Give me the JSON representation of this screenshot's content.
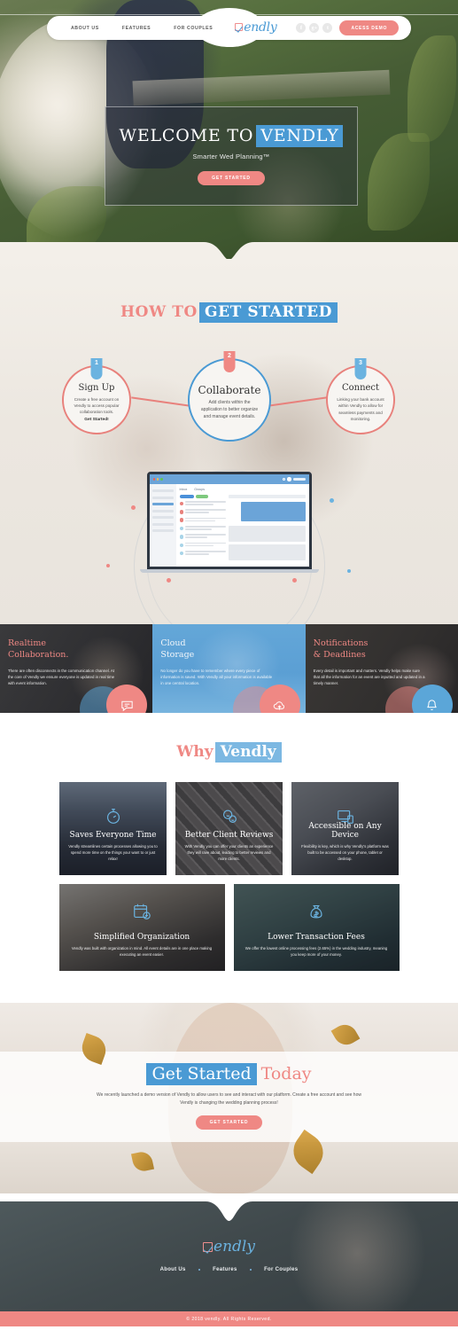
{
  "nav": {
    "links": [
      {
        "label": "ABOUT US",
        "name": "nav-about-us"
      },
      {
        "label": "FEATURES",
        "name": "nav-features"
      },
      {
        "label": "FOR COUPLES",
        "name": "nav-for-couples"
      }
    ],
    "logo": "endly",
    "socials": [
      {
        "name": "facebook-icon",
        "glyph": "f"
      },
      {
        "name": "google-plus-icon",
        "glyph": "g+"
      },
      {
        "name": "twitter-icon",
        "glyph": "t"
      }
    ],
    "demo_button": "ACESS DEMO"
  },
  "hero": {
    "title_prefix": "WELCOME TO",
    "title_highlight": "VENDLY",
    "subtitle": "Smarter Wed Planning™",
    "cta": "GET STARTED"
  },
  "howto": {
    "head_prefix": "HOW TO",
    "head_highlight": "GET STARTED",
    "steps": [
      {
        "number": "1",
        "title": "Sign Up",
        "body": "Create a free account on Vendly to access popular collaboration tools.",
        "cta": "Get Started!"
      },
      {
        "number": "2",
        "title": "Collaborate",
        "body": "Add clients within the application to better organize and manage event details.",
        "cta": ""
      },
      {
        "number": "3",
        "title": "Connect",
        "body": "Linking your bank account within Vendly to allow for seamless payments and monitoring.",
        "cta": ""
      }
    ],
    "app_tabs": [
      "Inbox",
      "Groups"
    ]
  },
  "panels": [
    {
      "title_line1": "Realtime",
      "title_line2": "Collaboration.",
      "body": "There are often disconnects in the communication channel. At the core of Vendly we ensure everyone is updated in real time with event information.",
      "icon": "chat-bubble-icon"
    },
    {
      "title_line1": "Cloud",
      "title_line2": "Storage",
      "body": "No longer do you have to remember where every piece of information is saved. With Vendly all your information is available in one central location.",
      "icon": "cloud-upload-icon"
    },
    {
      "title_line1": "Notifications",
      "title_line2": "& Deadlines",
      "body": "Every detail is important and matters. Vendly helps make sure that all the information for an event are inputted and updated in a timely manner.",
      "icon": "bell-icon"
    }
  ],
  "why": {
    "head_prefix": "Why",
    "head_highlight": "Vendly",
    "cards_row1": [
      {
        "title": "Saves Everyone Time",
        "body": "Vendly streamlines certain processes allowing you to spend more time on the things your want to or just relax!",
        "icon": "stopwatch-icon"
      },
      {
        "title": "Better Client Reviews",
        "body": "With Vendly you can offer your clients an experience they will rave about, leading to better reviews and more clients.",
        "icon": "smiley-chat-icon"
      },
      {
        "title": "Accessible on Any Device",
        "body": "Flexibility is key, which is why Vendly's platform was built to be accessed on your phone, tablet or desktop.",
        "icon": "devices-icon"
      }
    ],
    "cards_row2": [
      {
        "title": "Simplified Organization",
        "body": "Vendly was built with organization in mind. All event details are in one place making executing an event easier.",
        "icon": "calendar-plus-icon"
      },
      {
        "title": "Lower Transaction Fees",
        "body": "We offer the lowest online processing fees (2.65%) in the wedding industry, meaning you keep more of your money.",
        "icon": "money-bag-icon"
      }
    ]
  },
  "cta_section": {
    "head_highlight": "Get Started",
    "head_suffix": "Today",
    "body": "We recently launched a demo version of Vendly to allow users to see and interact with our platform. Create a free account and see how Vendly is changing the wedding planning process!",
    "button": "GET STARTED"
  },
  "footer": {
    "logo": "endly",
    "links": [
      {
        "label": "About Us",
        "name": "footer-about-us"
      },
      {
        "label": "Features",
        "name": "footer-features"
      },
      {
        "label": "For Couples",
        "name": "footer-for-couples"
      }
    ],
    "copyright": "© 2018 vendly. All Rights Reserved."
  },
  "colors": {
    "pink": "#ef8884",
    "blue": "#4a9ad4",
    "light_blue": "#7cb8e2"
  }
}
